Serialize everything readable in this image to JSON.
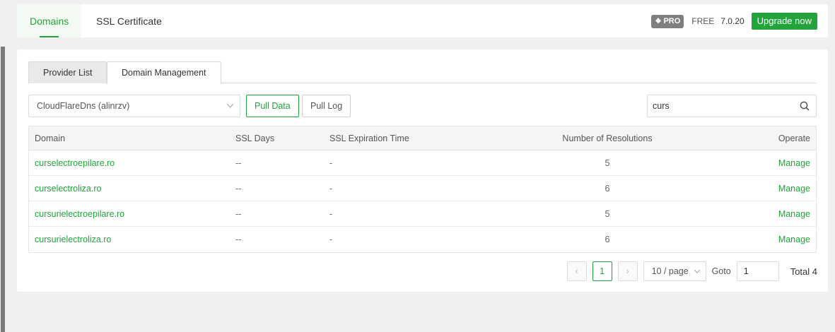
{
  "top_tabs": [
    {
      "label": "Domains",
      "active": true
    },
    {
      "label": "SSL Certificate",
      "active": false
    }
  ],
  "header": {
    "pro_badge": "PRO",
    "plan_label": "FREE",
    "version": "7.0.20",
    "upgrade_label": "Upgrade now"
  },
  "sub_tabs": [
    {
      "label": "Provider List",
      "active": false
    },
    {
      "label": "Domain Management",
      "active": true
    }
  ],
  "toolbar": {
    "provider_select": "CloudFlareDns (alinrzv)",
    "pull_data_label": "Pull Data",
    "pull_log_label": "Pull Log",
    "search_value": "curs"
  },
  "table": {
    "headers": {
      "domain": "Domain",
      "ssl_days": "SSL Days",
      "ssl_expiration": "SSL Expiration Time",
      "resolutions": "Number of Resolutions",
      "operate": "Operate"
    },
    "rows": [
      {
        "domain": "curselectroepilare.ro",
        "ssl_days": "--",
        "ssl_expiration": "-",
        "resolutions": "5",
        "operate": "Manage"
      },
      {
        "domain": "curselectroliza.ro",
        "ssl_days": "--",
        "ssl_expiration": "-",
        "resolutions": "6",
        "operate": "Manage"
      },
      {
        "domain": "cursurielectroepilare.ro",
        "ssl_days": "--",
        "ssl_expiration": "-",
        "resolutions": "5",
        "operate": "Manage"
      },
      {
        "domain": "cursurielectroliza.ro",
        "ssl_days": "--",
        "ssl_expiration": "-",
        "resolutions": "6",
        "operate": "Manage"
      }
    ]
  },
  "pagination": {
    "prev_icon": "‹",
    "current_page": "1",
    "next_icon": "›",
    "page_size": "10 / page",
    "goto_label": "Goto",
    "goto_value": "1",
    "total_label": "Total 4"
  },
  "colors": {
    "accent": "#20a53a",
    "pro_badge": "#7f7f7f"
  }
}
